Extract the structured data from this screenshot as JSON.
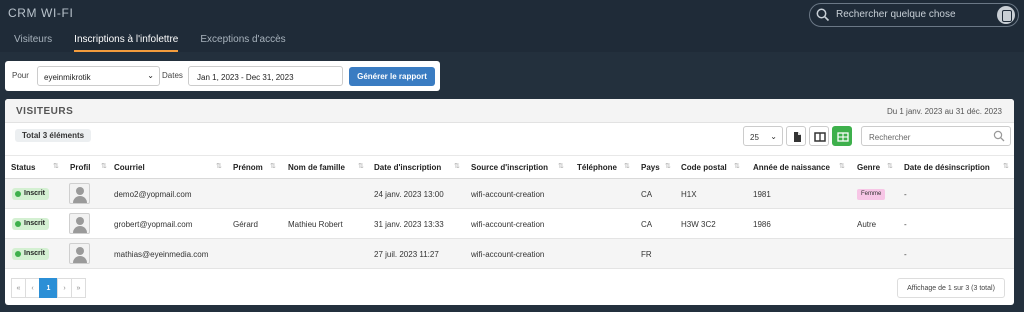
{
  "app": {
    "title": "CRM WI-FI"
  },
  "tabs": [
    {
      "label": "Visiteurs"
    },
    {
      "label": "Inscriptions à l'infolettre"
    },
    {
      "label": "Exceptions d'accès"
    }
  ],
  "active_tab": 1,
  "global_search": {
    "placeholder": "Rechercher quelque chose",
    "icon": "search-icon"
  },
  "filters": {
    "location_label": "Pour",
    "location_value": "eyeinmikrotik",
    "dates_label": "Dates",
    "dates_value": "Jan 1, 2023 - Dec 31, 2023",
    "generate_label": "Générer le rapport"
  },
  "panel": {
    "title": "VISITEURS",
    "range": "Du 1 janv. 2023 au 31 déc. 2023",
    "total": "Total 3 éléments",
    "page_size": "25",
    "search_placeholder": "Rechercher"
  },
  "columns": [
    "Status",
    "Profil",
    "Courriel",
    "Prénom",
    "Nom de famille",
    "Date d'inscription",
    "Source d'inscription",
    "Téléphone",
    "Pays",
    "Code postal",
    "Année de naissance",
    "Genre",
    "Date de désinscription"
  ],
  "rows": [
    {
      "status": "Inscrit",
      "email": "demo2@yopmail.com",
      "first": "",
      "last": "",
      "date": "24 janv. 2023 13:00",
      "source": "wifi-account-creation",
      "phone": "",
      "country": "CA",
      "postal": "H1X",
      "birth": "1981",
      "gender": "Femme",
      "unsub": "-"
    },
    {
      "status": "Inscrit",
      "email": "grobert@yopmail.com",
      "first": "Gérard",
      "last": "Mathieu Robert",
      "date": "31 janv. 2023 13:33",
      "source": "wifi-account-creation",
      "phone": "",
      "country": "CA",
      "postal": "H3W 3C2",
      "birth": "1986",
      "gender": "Autre",
      "unsub": "-"
    },
    {
      "status": "Inscrit",
      "email": "mathias@eyeinmedia.com",
      "first": "",
      "last": "",
      "date": "27 juil. 2023 11:27",
      "source": "wifi-account-creation",
      "phone": "",
      "country": "FR",
      "postal": "",
      "birth": "",
      "gender": "",
      "unsub": "-"
    }
  ],
  "pager": {
    "first": "«",
    "prev": "‹",
    "current": "1",
    "next": "›",
    "last": "»",
    "info": "Affichage de 1 sur 3 (3 total)"
  },
  "colors": {
    "accent": "#f39c3d",
    "primary": "#3a7cc2",
    "success": "#3eb04c",
    "page_active": "#2b8fd6"
  }
}
